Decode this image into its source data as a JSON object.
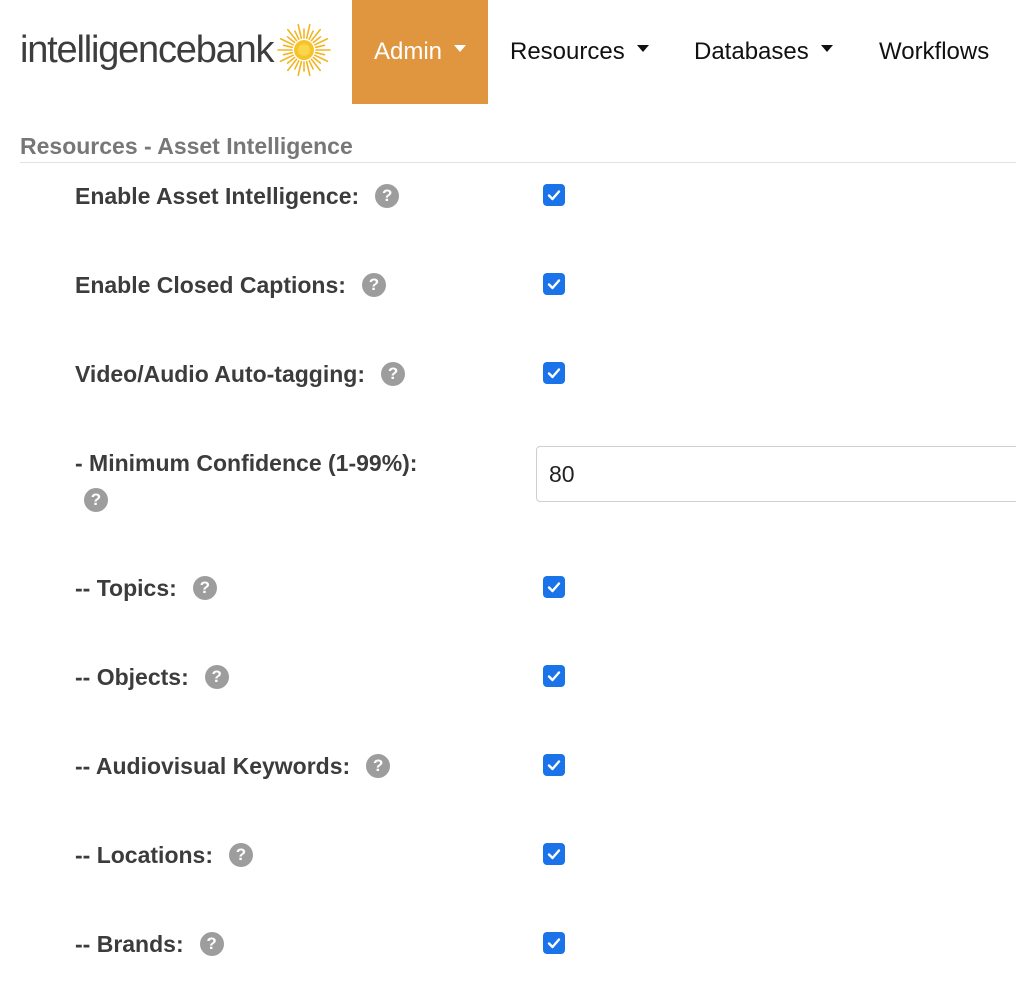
{
  "brand": {
    "logo_text": "intelligencebank",
    "sun_color": "#f3b422"
  },
  "nav": {
    "items": [
      {
        "label": "Admin",
        "active": true,
        "dropdown": true
      },
      {
        "label": "Resources",
        "active": false,
        "dropdown": true
      },
      {
        "label": "Databases",
        "active": false,
        "dropdown": true
      },
      {
        "label": "Workflows",
        "active": false,
        "dropdown": false
      }
    ],
    "active_color": "#e0963e"
  },
  "section": {
    "title": "Resources - Asset Intelligence"
  },
  "settings": [
    {
      "label": "Enable Asset Intelligence:",
      "checked": true
    },
    {
      "label": "Enable Closed Captions:",
      "checked": true
    },
    {
      "label": "Video/Audio Auto-tagging:",
      "checked": true
    }
  ],
  "confidence": {
    "label": "- Minimum Confidence (1-99%):",
    "value": "80"
  },
  "sub_settings": [
    {
      "label": "-- Topics:",
      "checked": true
    },
    {
      "label": "-- Objects:",
      "checked": true
    },
    {
      "label": "-- Audiovisual Keywords:",
      "checked": true
    },
    {
      "label": "-- Locations:",
      "checked": true
    },
    {
      "label": "-- Brands:",
      "checked": true
    }
  ],
  "help_glyph": "?",
  "checkbox_color": "#1a73e8"
}
